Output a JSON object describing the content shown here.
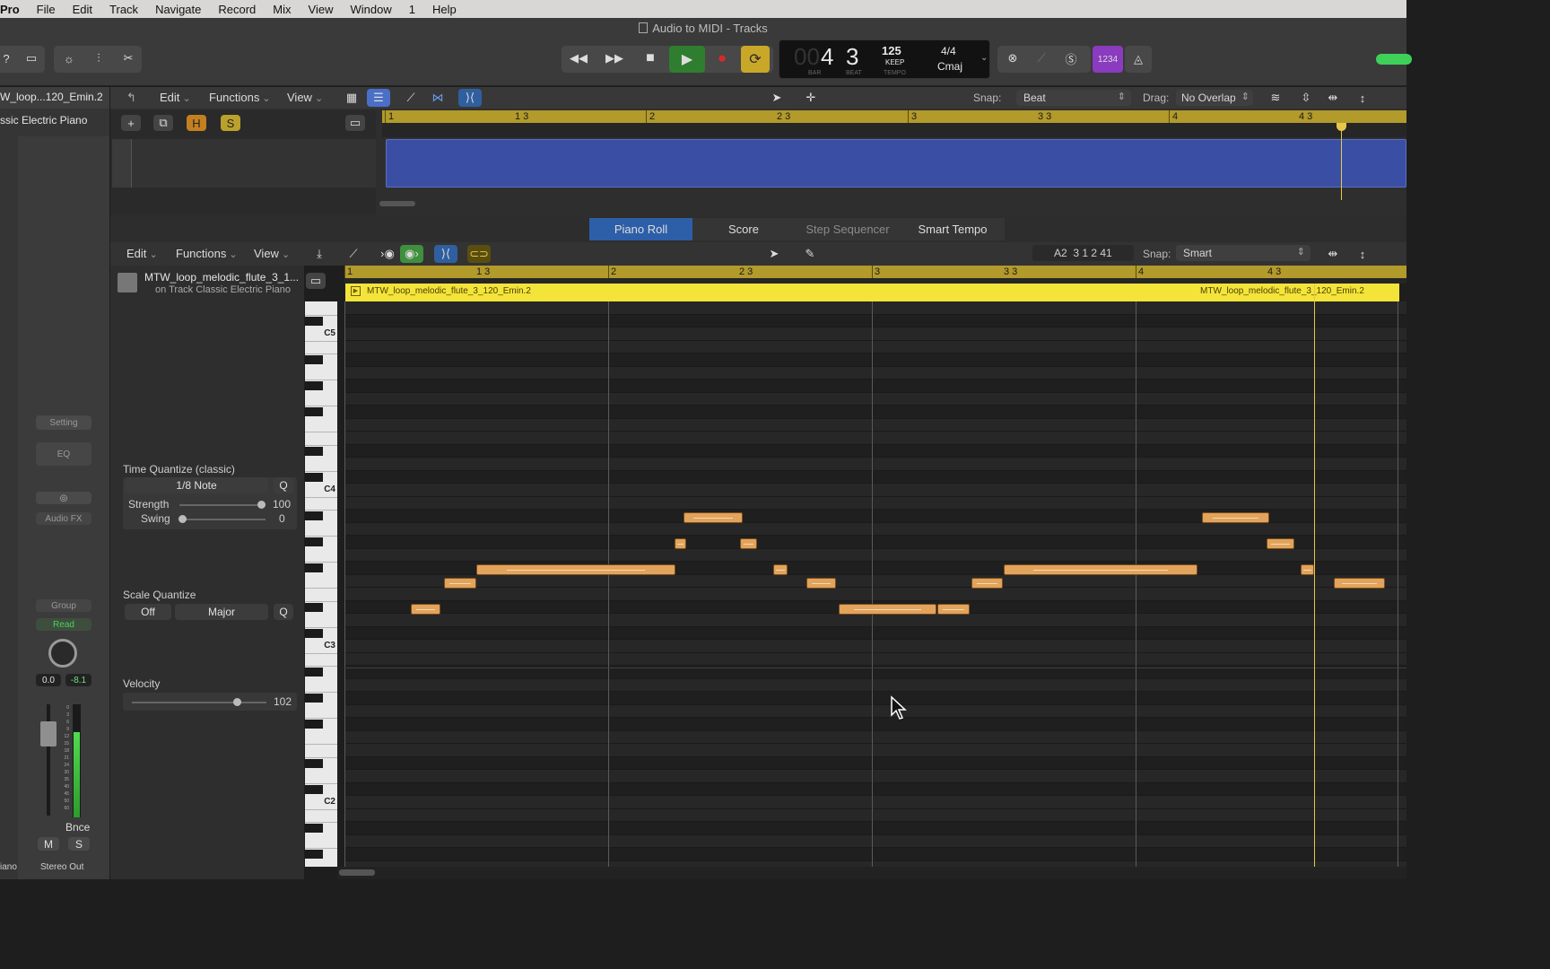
{
  "menubar": {
    "app": "Pro",
    "items": [
      "File",
      "Edit",
      "Track",
      "Navigate",
      "Record",
      "Mix",
      "View",
      "Window",
      "1",
      "Help"
    ]
  },
  "window": {
    "title": "Audio to MIDI - Tracks"
  },
  "transport": {
    "lcd": {
      "bar_prefix": "00",
      "bar": "4",
      "beat": "3",
      "bar_caption": "BAR",
      "beat_caption": "BEAT",
      "tempo": "125",
      "tempo_mode": "KEEP",
      "tempo_caption": "TEMPO",
      "signature": "4/4",
      "key": "Cmaj"
    },
    "count_in": "1234"
  },
  "tracks_area": {
    "track_name": "W_loop...120_Emin.2",
    "track_sub": "ssic Electric Piano",
    "menus": {
      "edit": "Edit",
      "functions": "Functions",
      "view": "View"
    },
    "snap_label": "Snap:",
    "snap_value": "Beat",
    "drag_label": "Drag:",
    "drag_value": "No Overlap",
    "buttons": {
      "add": "+",
      "h": "H",
      "s": "S"
    },
    "ruler": [
      "1",
      "1 3",
      "2",
      "2 3",
      "3",
      "3 3",
      "4",
      "4 3"
    ]
  },
  "tabs": [
    "Piano Roll",
    "Score",
    "Step Sequencer",
    "Smart Tempo"
  ],
  "editor": {
    "menus": {
      "edit": "Edit",
      "functions": "Functions",
      "view": "View"
    },
    "position": "A2  3 1 2 41",
    "snap_label": "Snap:",
    "snap_value": "Smart",
    "region_name": "MTW_loop_melodic_flute_3_1...",
    "region_track": "on Track Classic Electric Piano",
    "region_bar_name_left": "MTW_loop_melodic_flute_3_120_Emin.2",
    "region_bar_name_right": "MTW_loop_melodic_flute_3_120_Emin.2",
    "ruler": [
      "1",
      "1 3",
      "2",
      "2 3",
      "3",
      "3 3",
      "4",
      "4 3"
    ],
    "octaves": [
      "C5",
      "C4",
      "C3",
      "C2"
    ]
  },
  "inspector": {
    "time_quantize_title": "Time Quantize (classic)",
    "time_quantize_value": "1/8 Note",
    "q": "Q",
    "strength_label": "Strength",
    "strength_value": "100",
    "swing_label": "Swing",
    "swing_value": "0",
    "scale_quantize_title": "Scale Quantize",
    "scale_off": "Off",
    "scale_mode": "Major",
    "velocity_title": "Velocity",
    "velocity_value": "102"
  },
  "channel_strip": {
    "setting": "Setting",
    "eq": "EQ",
    "audio_fx": "Audio FX",
    "group": "Group",
    "automation": "Read",
    "pan_value": "0.0",
    "peak": "-8.1",
    "bounce": "Bnce",
    "mute": "M",
    "solo": "S",
    "output": "Stereo Out",
    "left_edge": "iano",
    "fader_scale": [
      "0",
      "3",
      "6",
      "9",
      "12",
      "15",
      "18",
      "21",
      "24",
      "30",
      "35",
      "40",
      "45",
      "50",
      "60"
    ]
  },
  "colors": {
    "region_blue": "#3a4fa3",
    "ruler_gold": "#b29a2b",
    "note": "#e2a35c",
    "play": "#2f7d2f",
    "record": "#d42a2a",
    "cycle": "#c9a729",
    "purple": "#8a3bbf",
    "playhead": "#e8c64a"
  }
}
